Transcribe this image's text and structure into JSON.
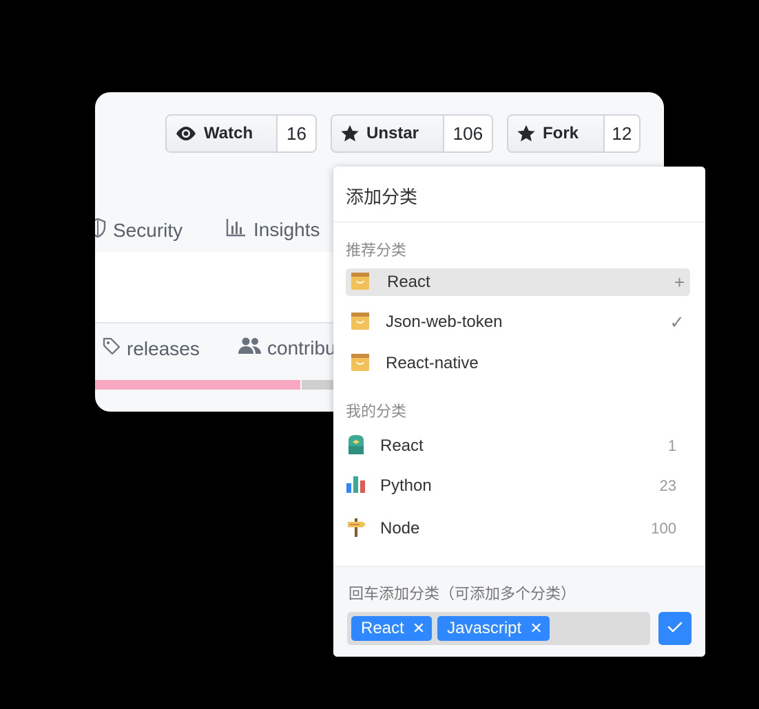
{
  "repo_header": {
    "buttons": [
      {
        "label": "Watch",
        "count": "16",
        "icon": "eye-icon"
      },
      {
        "label": "Unstar",
        "count": "106",
        "icon": "star-icon"
      },
      {
        "label": "Fork",
        "count": "12",
        "icon": "star-icon"
      }
    ],
    "tabs": [
      {
        "label": "Security",
        "icon": "shield-icon"
      },
      {
        "label": "Insights",
        "icon": "graph-icon"
      }
    ],
    "stats": [
      {
        "label": "releases",
        "icon": "tag-icon"
      },
      {
        "label": "contribu",
        "icon": "people-icon"
      }
    ],
    "language_bar_colors": [
      "#f9a8c1",
      "#cfcfcf"
    ]
  },
  "popup": {
    "title": "添加分类",
    "recommended": {
      "label": "推荐分类",
      "items": [
        {
          "label": "React",
          "icon": "bag-icon",
          "action": "+",
          "highlighted": true
        },
        {
          "label": "Json-web-token",
          "icon": "bag-icon",
          "action": "✓",
          "highlighted": false
        },
        {
          "label": "React-native",
          "icon": "bag-icon",
          "action": "",
          "highlighted": false
        }
      ]
    },
    "mine": {
      "label": "我的分类",
      "items": [
        {
          "label": "React",
          "icon": "backpack-icon",
          "count": "1"
        },
        {
          "label": "Python",
          "icon": "bar-chart-icon",
          "count": "23"
        },
        {
          "label": "Node",
          "icon": "signpost-icon",
          "count": "100"
        }
      ]
    },
    "footer": {
      "hint": "回车添加分类（可添加多个分类）",
      "tags": [
        "React",
        "Javascript"
      ],
      "confirm_icon": "check-icon"
    }
  },
  "colors": {
    "accent": "#2f88ff",
    "background": "#000000",
    "card": "#f6f8fa"
  }
}
